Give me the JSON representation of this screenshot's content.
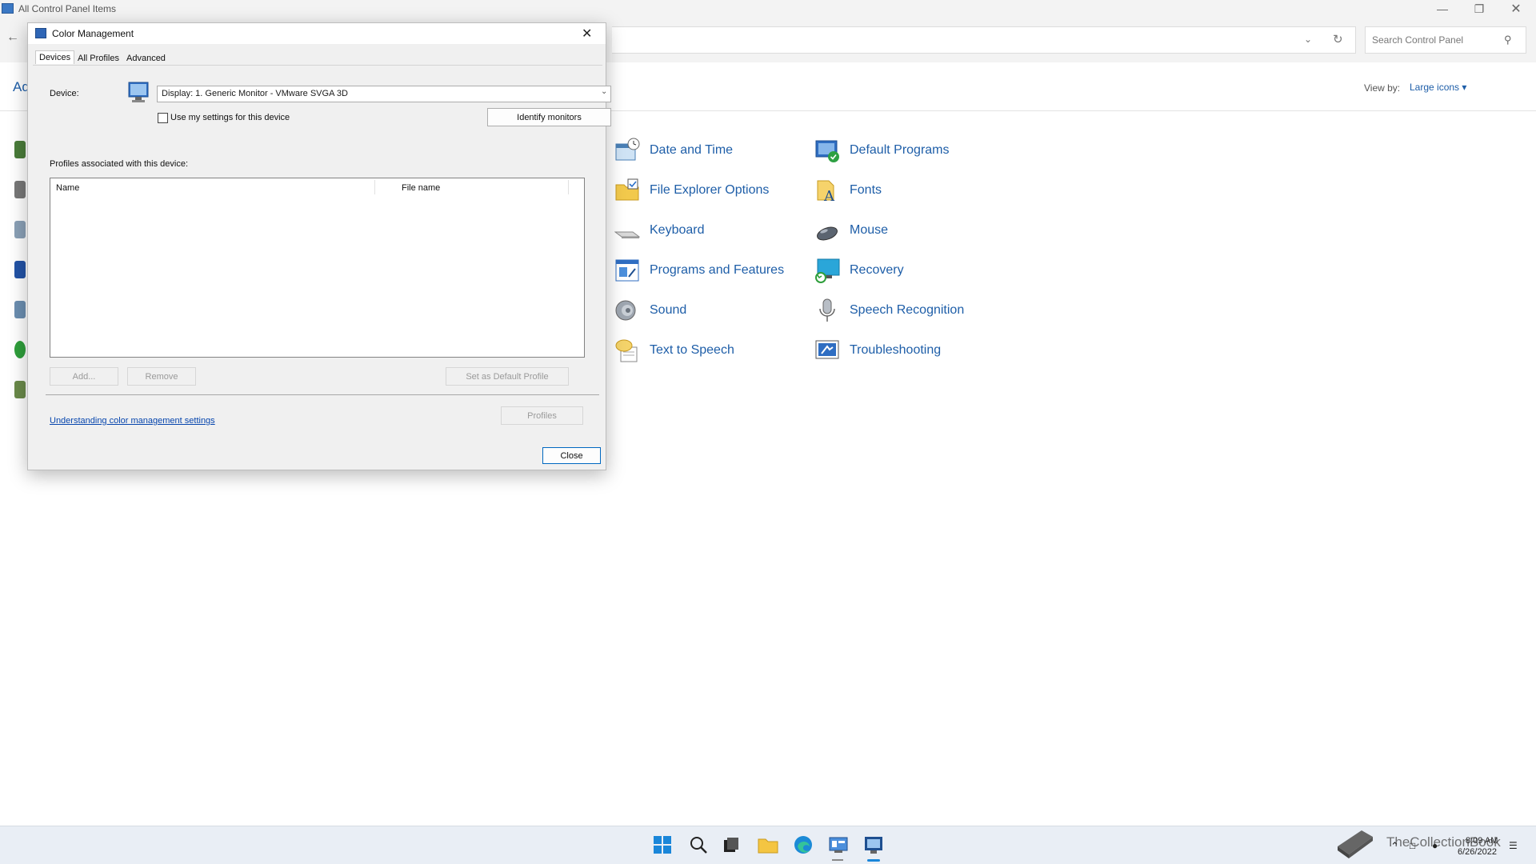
{
  "control_panel": {
    "window_title": "All Control Panel Items",
    "search_placeholder": "Search Control Panel",
    "adjust_text_partial": "Ad",
    "view_by_label": "View by:",
    "view_by_value": "Large icons ▾",
    "items": [
      {
        "label": "Date and Time",
        "icon": "date-time-icon"
      },
      {
        "label": "Default Programs",
        "icon": "default-programs-icon"
      },
      {
        "label": "File Explorer Options",
        "icon": "folder-options-icon"
      },
      {
        "label": "Fonts",
        "icon": "fonts-icon"
      },
      {
        "label": "Keyboard",
        "icon": "keyboard-icon"
      },
      {
        "label": "Mouse",
        "icon": "mouse-icon"
      },
      {
        "label": "Programs and Features",
        "icon": "programs-features-icon"
      },
      {
        "label": "Recovery",
        "icon": "recovery-icon"
      },
      {
        "label": "Sound",
        "icon": "speaker-icon"
      },
      {
        "label": "Speech Recognition",
        "icon": "microphone-icon"
      },
      {
        "label": "Text to Speech",
        "icon": "speech-bubble-icon"
      },
      {
        "label": "Troubleshooting",
        "icon": "troubleshooting-icon"
      }
    ]
  },
  "color_management": {
    "title": "Color Management",
    "tabs": [
      "Devices",
      "All Profiles",
      "Advanced"
    ],
    "device_label": "Device:",
    "device_value": "Display: 1. Generic Monitor - VMware SVGA 3D",
    "use_settings_label": "Use my settings for this device",
    "use_settings_checked": false,
    "identify_button": "Identify monitors",
    "profiles_label": "Profiles associated with this device:",
    "columns": [
      "Name",
      "File name"
    ],
    "add_button": "Add...",
    "remove_button": "Remove",
    "set_default_button": "Set as Default Profile",
    "link_text": "Understanding color management settings",
    "profiles_button": "Profiles",
    "close_button": "Close"
  },
  "taskbar": {
    "time": "8:09 AM",
    "date": "6/26/2022",
    "watermark": "TheCollectionBook",
    "icons": [
      "start-icon",
      "search-icon",
      "task-view-icon",
      "file-explorer-icon",
      "edge-icon",
      "control-panel-icon",
      "color-management-icon"
    ]
  },
  "colors": {
    "link_blue": "#1e5ea8",
    "accent": "#0067c0"
  }
}
